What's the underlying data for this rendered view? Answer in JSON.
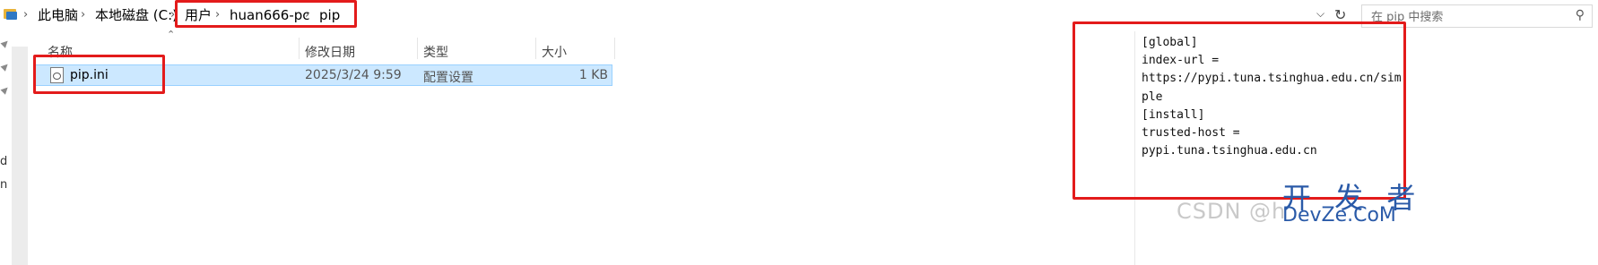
{
  "breadcrumb": {
    "items": [
      "此电脑",
      "本地磁盘 (C:)",
      "用户",
      "huan666-pc",
      "pip"
    ],
    "separator": "›"
  },
  "search": {
    "placeholder": "在 pip 中搜索"
  },
  "icons": {
    "folder": "folder-icon",
    "dropdown": "chevron-down-icon",
    "refresh": "refresh-icon",
    "search": "search-icon",
    "pin": "pin-icon",
    "file": "settings-file-icon"
  },
  "columns": {
    "name": "名称",
    "modified": "修改日期",
    "type": "类型",
    "size": "大小"
  },
  "files": [
    {
      "name": "pip.ini",
      "modified": "2025/3/24 9:59",
      "type": "配置设置",
      "size": "1 KB"
    }
  ],
  "nav_fragments": [
    "d",
    "n"
  ],
  "preview": {
    "content": "[global]\nindex-url =\nhttps://pypi.tuna.tsinghua.edu.cn/sim\nple\n[install]\ntrusted-host =\npypi.tuna.tsinghua.edu.cn"
  },
  "watermarks": {
    "csdn": "CSDN @h",
    "kaifa": "开 发 者",
    "devze": "DevZe.CoM"
  },
  "colors": {
    "selection_bg": "#cce8ff",
    "selection_border": "#99d1ff",
    "highlight_box": "#e31b1b",
    "watermark_brand": "#2a5aa8"
  }
}
